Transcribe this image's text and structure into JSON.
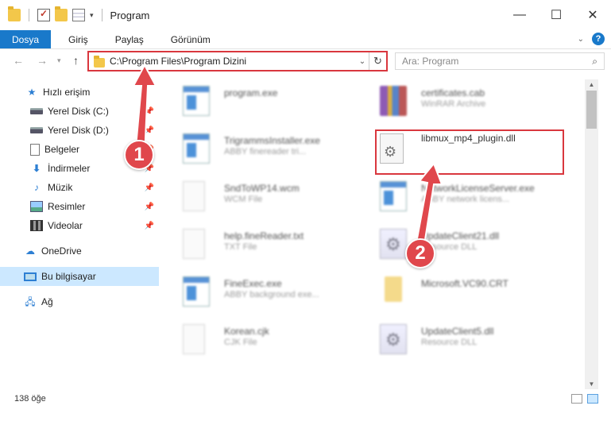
{
  "window": {
    "title": "Program",
    "controls": {
      "minimize": "—",
      "maximize": "☐",
      "close": "✕"
    }
  },
  "ribbon": {
    "tabs": [
      {
        "label": "Dosya",
        "active": true
      },
      {
        "label": "Giriş"
      },
      {
        "label": "Paylaş"
      },
      {
        "label": "Görünüm"
      }
    ],
    "help": "?"
  },
  "address": {
    "path": "C:\\Program Files\\Program Dizini",
    "search_placeholder": "Ara: Program"
  },
  "sidebar": {
    "items": [
      {
        "label": "Hızlı erişim",
        "icon": "star-icon"
      },
      {
        "label": "Yerel Disk (C:)",
        "icon": "drive-icon",
        "pinned": true
      },
      {
        "label": "Yerel Disk (D:)",
        "icon": "drive-icon",
        "pinned": true
      },
      {
        "label": "Belgeler",
        "icon": "document-icon",
        "pinned": true
      },
      {
        "label": "İndirmeler",
        "icon": "download-icon",
        "pinned": true
      },
      {
        "label": "Müzik",
        "icon": "music-icon",
        "pinned": true
      },
      {
        "label": "Resimler",
        "icon": "picture-icon",
        "pinned": true
      },
      {
        "label": "Videolar",
        "icon": "video-icon",
        "pinned": true
      },
      {
        "label": "OneDrive",
        "icon": "cloud-icon"
      },
      {
        "label": "Bu bilgisayar",
        "icon": "computer-icon",
        "selected": true
      },
      {
        "label": "Ağ",
        "icon": "network-icon"
      }
    ]
  },
  "files": [
    {
      "name": "program.exe",
      "type": "",
      "icon": "exe-icon"
    },
    {
      "name": "certificates.cab",
      "type": "WinRAR Archive",
      "icon": "rar-icon"
    },
    {
      "name": "TrigrammsInstaller.exe",
      "type": "ABBY finereader tri...",
      "icon": "exe-icon"
    },
    {
      "name": "libmux_mp4_plugin.dll",
      "type": "",
      "icon": "dll-icon"
    },
    {
      "name": "SndToWP14.wcm",
      "type": "WCM File",
      "icon": "blank-file-icon"
    },
    {
      "name": "NetworkLicenseServer.exe",
      "type": "ABBY network licens...",
      "icon": "exe-icon"
    },
    {
      "name": "help.fineReader.txt",
      "type": "TXT File",
      "icon": "blank-file-icon"
    },
    {
      "name": "UpdateClient21.dll",
      "type": "Resource DLL",
      "icon": "gear-file-icon"
    },
    {
      "name": "FineExec.exe",
      "type": "ABBY background exe...",
      "icon": "exe-icon"
    },
    {
      "name": "Microsoft.VC90.CRT",
      "type": "",
      "icon": "folder-icon"
    },
    {
      "name": "Korean.cjk",
      "type": "CJK File",
      "icon": "blank-file-icon"
    },
    {
      "name": "UpdateClient5.dll",
      "type": "Resource DLL",
      "icon": "gear-file-icon"
    }
  ],
  "annotations": {
    "step1": "1",
    "step2": "2",
    "color": "#e0474c"
  },
  "status": {
    "count": "138 öğe"
  },
  "colors": {
    "accent": "#1979ca",
    "highlight": "#d9373e",
    "selected": "#cce8ff"
  }
}
